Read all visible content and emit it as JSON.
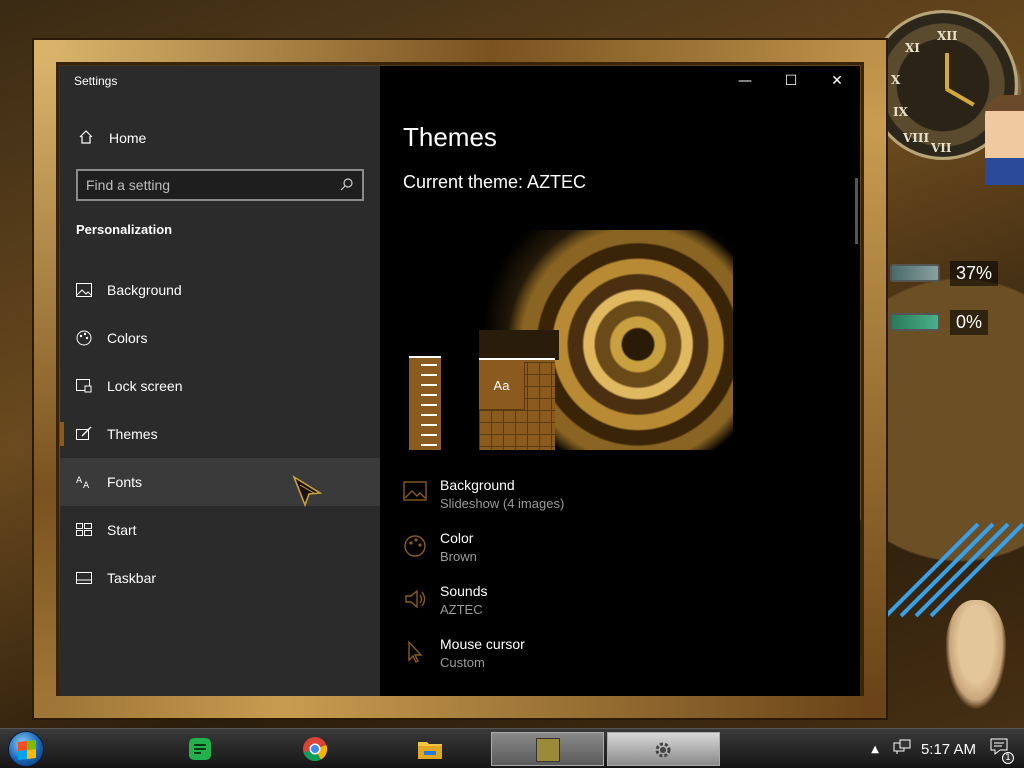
{
  "window": {
    "app_title": "Settings",
    "controls": {
      "minimize": "—",
      "maximize": "☐",
      "close": "✕"
    }
  },
  "sidebar": {
    "home_label": "Home",
    "search_placeholder": "Find a setting",
    "section_title": "Personalization",
    "items": [
      {
        "label": "Background",
        "icon": "image-icon"
      },
      {
        "label": "Colors",
        "icon": "palette-icon"
      },
      {
        "label": "Lock screen",
        "icon": "lock-screen-icon"
      },
      {
        "label": "Themes",
        "icon": "themes-icon",
        "selected": true
      },
      {
        "label": "Fonts",
        "icon": "fonts-icon",
        "hover": true
      },
      {
        "label": "Start",
        "icon": "start-icon"
      },
      {
        "label": "Taskbar",
        "icon": "taskbar-icon"
      }
    ]
  },
  "main": {
    "title": "Themes",
    "current_theme": "Current theme: AZTEC",
    "preview_tile_text": "Aa",
    "settings": [
      {
        "name": "Background",
        "value": "Slideshow (4 images)",
        "icon": "image-icon"
      },
      {
        "name": "Color",
        "value": "Brown",
        "icon": "palette-icon"
      },
      {
        "name": "Sounds",
        "value": "AZTEC",
        "icon": "speaker-icon"
      },
      {
        "name": "Mouse cursor",
        "value": "Custom",
        "icon": "cursor-icon"
      }
    ]
  },
  "desktop": {
    "meter_cpu": "37%",
    "meter_mem": "0%",
    "clock_numerals": [
      "XII",
      "XI",
      "X",
      "IX",
      "VIII",
      "VII"
    ]
  },
  "taskbar": {
    "time": "5:17 AM",
    "notification_count": "1"
  },
  "colors": {
    "accent": "#8b5a1e",
    "sidebar_bg": "#2b2b2b",
    "content_bg": "#000000"
  }
}
